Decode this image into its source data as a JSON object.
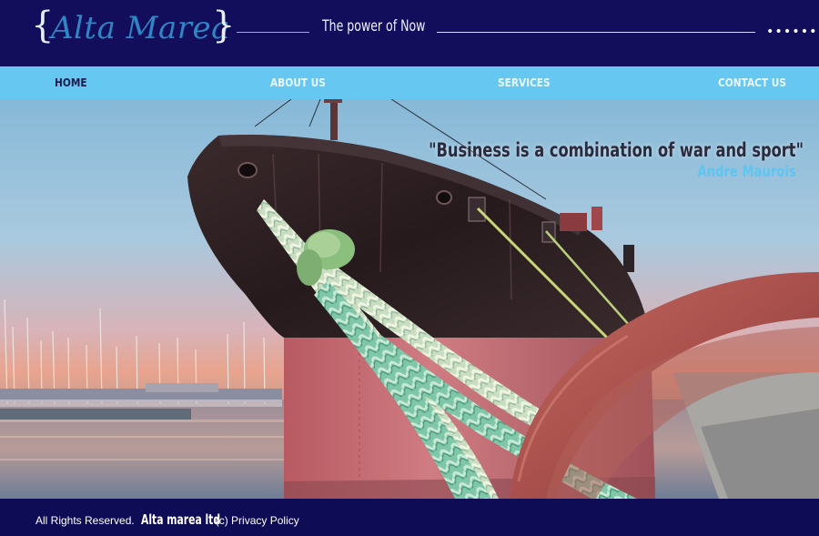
{
  "header": {
    "logo_brace_left": "{",
    "logo_text": "Alta Marea",
    "logo_brace_right": "}",
    "tagline": "The power of Now"
  },
  "nav": {
    "items": [
      {
        "label": "HOME",
        "active": true
      },
      {
        "label": "ABOUT US",
        "active": false
      },
      {
        "label": "SERVICES",
        "active": false
      },
      {
        "label": "CONTACT US",
        "active": false
      }
    ]
  },
  "hero": {
    "quote": "\"Business is a combination of war and sport\"",
    "author": "Andre Maurois"
  },
  "footer": {
    "rights": "All Rights Reserved.",
    "brand": "Alta marea ltd",
    "privacy": "(c) Privacy Policy"
  },
  "colors": {
    "header_bg": "#120e5c",
    "nav_bg": "#66c8f1",
    "logo_blue": "#2f86c4",
    "author_blue": "#5ec4f2"
  }
}
